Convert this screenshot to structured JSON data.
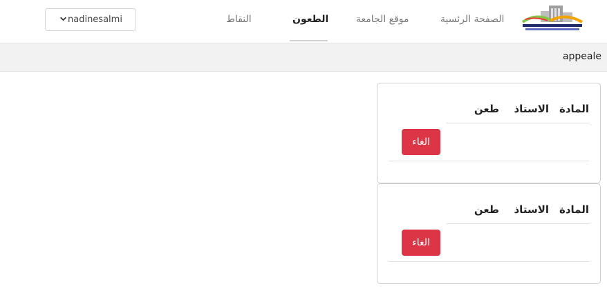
{
  "header": {
    "nav": {
      "home": "الصفحة الرئسية",
      "university_site": "موقع الجامعة",
      "appeals": "الطعون",
      "points": "النقاط"
    },
    "user": {
      "username": "nadinesalmi"
    }
  },
  "page": {
    "title": "appeale"
  },
  "appeal_cards": [
    {
      "headers": {
        "subject": "المادة",
        "professor": "الاستاذ",
        "appeal": "طعن"
      },
      "cancel_label": "الغاء"
    },
    {
      "headers": {
        "subject": "المادة",
        "professor": "الاستاذ",
        "appeal": "طعن"
      },
      "cancel_label": "الغاء"
    }
  ],
  "colors": {
    "cancel": "#dc3545",
    "subbar": "#f2f2f2",
    "active_nav": "#222222",
    "nav": "#777777"
  },
  "icons": {
    "logo": "university-logo",
    "dropdown": "chevron-down-icon"
  }
}
